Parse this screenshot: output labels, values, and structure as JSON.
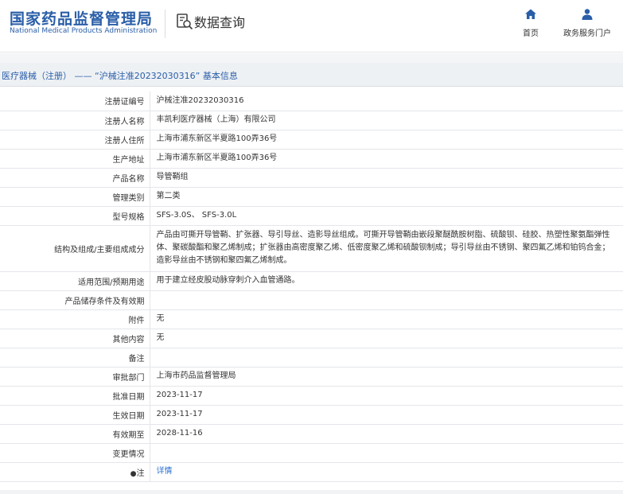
{
  "header": {
    "logo_cn": "国家药品监督管理局",
    "logo_en": "National Medical Products Administration",
    "query_title": "数据查询",
    "nav": [
      {
        "label": "首页",
        "icon": "home-icon"
      },
      {
        "label": "政务服务门户",
        "icon": "user-icon"
      }
    ]
  },
  "breadcrumb": "医疗器械（注册） —— “沪械注准20232030316” 基本信息",
  "rows": [
    {
      "label": "注册证编号",
      "value": "沪械注准20232030316"
    },
    {
      "label": "注册人名称",
      "value": "丰凯利医疗器械（上海）有限公司"
    },
    {
      "label": "注册人住所",
      "value": "上海市浦东新区半夏路100弄36号"
    },
    {
      "label": "生产地址",
      "value": "上海市浦东新区半夏路100弄36号"
    },
    {
      "label": "产品名称",
      "value": "导管鞘组"
    },
    {
      "label": "管理类别",
      "value": "第二类"
    },
    {
      "label": "型号规格",
      "value": "SFS-3.0S、 SFS-3.0L"
    },
    {
      "label": "结构及组成/主要组成成分",
      "value": "产品由可撕开导管鞘、扩张器、导引导丝、造影导丝组成。可撕开导管鞘由嵌段聚醚酰胺树脂、硫酸钡、硅胶、热塑性聚氨酯弹性体、聚碳酸酯和聚乙烯制成；扩张器由高密度聚乙烯、低密度聚乙烯和硫酸钡制成；导引导丝由不锈钢、聚四氟乙烯和铂钨合金；造影导丝由不锈钢和聚四氟乙烯制成。"
    },
    {
      "label": "适用范围/预期用途",
      "value": "用于建立经皮股动脉穿刺介入血管通路。"
    },
    {
      "label": "产品储存条件及有效期",
      "value": ""
    },
    {
      "label": "附件",
      "value": "无"
    },
    {
      "label": "其他内容",
      "value": "无"
    },
    {
      "label": "备注",
      "value": ""
    },
    {
      "label": "审批部门",
      "value": "上海市药品监督管理局"
    },
    {
      "label": "批准日期",
      "value": "2023-11-17"
    },
    {
      "label": "生效日期",
      "value": "2023-11-17"
    },
    {
      "label": "有效期至",
      "value": "2028-11-16"
    },
    {
      "label": "变更情况",
      "value": ""
    }
  ],
  "note": {
    "label": "注",
    "icon": "bullet-icon",
    "link": "详情"
  },
  "colors": {
    "brand": "#2a5ea8",
    "link": "#2a6fd1",
    "breadcrumb_bg": "#eef1f4"
  }
}
